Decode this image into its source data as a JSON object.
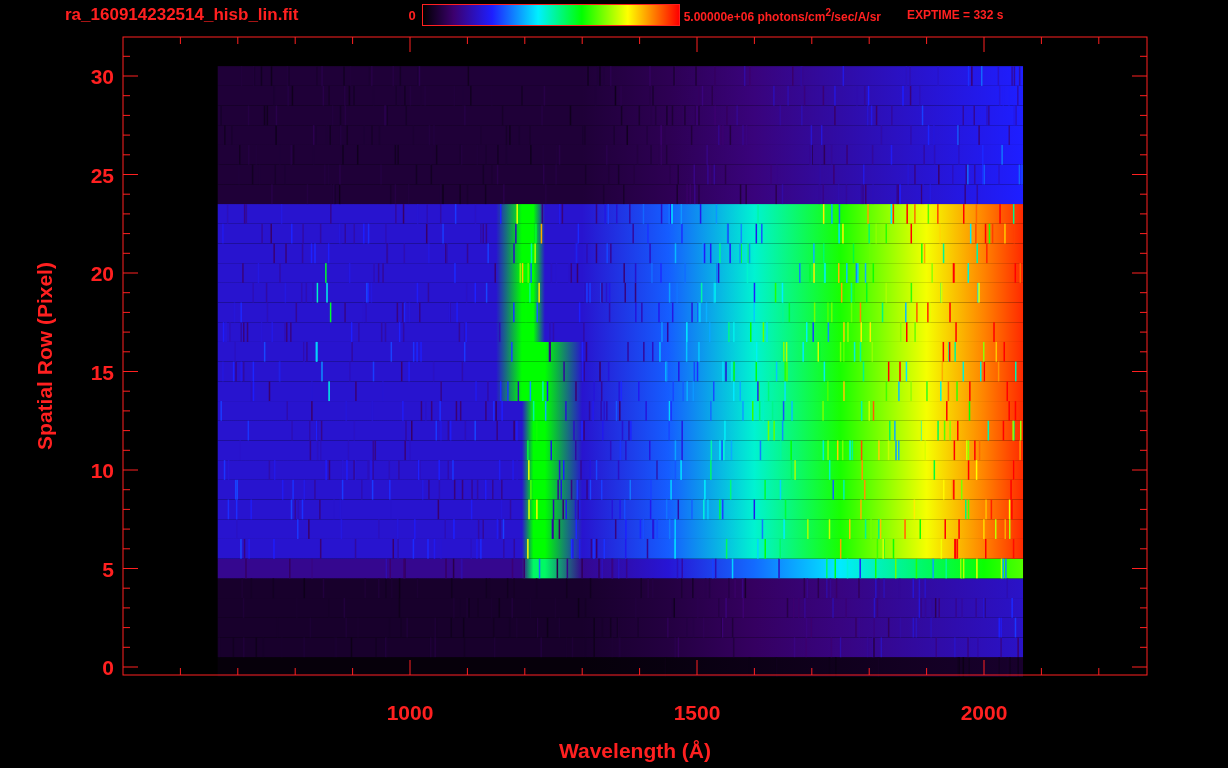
{
  "title": "ra_160914232514_hisb_lin.fit",
  "colorbar": {
    "min_label": "0",
    "max_label": "5.00000e+06 photons/cm$^{2}$/sec/A/sr"
  },
  "exptime": "EXPTIME = 332 s",
  "plot": {
    "xlabel": "Wavelength (Å)",
    "ylabel": "Spatial Row (Pixel)",
    "x_tick_labels": [
      "1000",
      "1500",
      "2000"
    ],
    "y_tick_labels": [
      "30",
      "25",
      "20",
      "15",
      "10",
      "5",
      "0"
    ]
  }
}
